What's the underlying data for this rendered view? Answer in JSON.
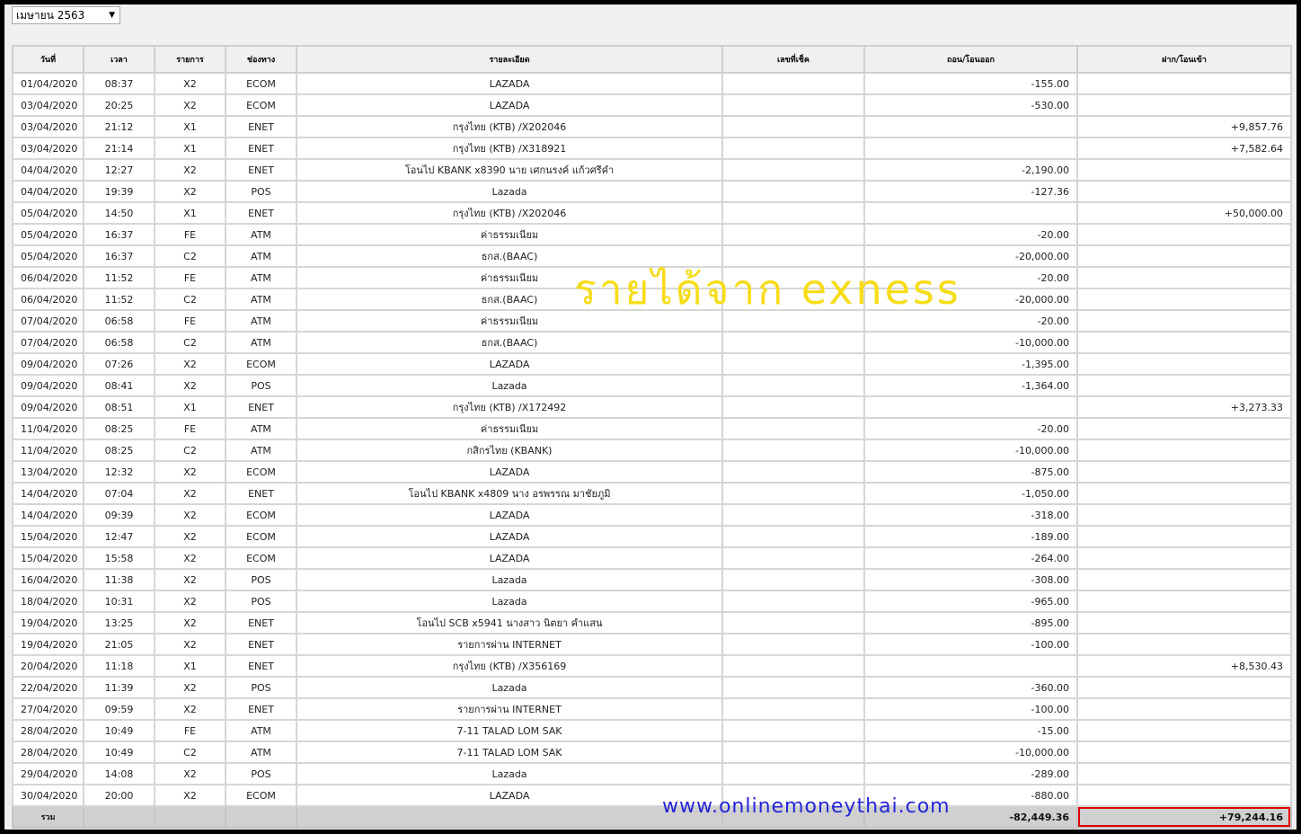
{
  "month_select": {
    "value": "เมษายน 2563",
    "arrow": "▼"
  },
  "table": {
    "headers": [
      "วันที่",
      "เวลา",
      "รายการ",
      "ช่องทาง",
      "รายละเอียด",
      "เลขที่เช็ค",
      "ถอน/โอนออก",
      "ฝาก/โอนเข้า"
    ],
    "rows": [
      [
        "01/04/2020",
        "08:37",
        "X2",
        "ECOM",
        "LAZADA",
        "",
        "-155.00",
        ""
      ],
      [
        "03/04/2020",
        "20:25",
        "X2",
        "ECOM",
        "LAZADA",
        "",
        "-530.00",
        ""
      ],
      [
        "03/04/2020",
        "21:12",
        "X1",
        "ENET",
        "กรุงไทย (KTB) /X202046",
        "",
        "",
        "+9,857.76"
      ],
      [
        "03/04/2020",
        "21:14",
        "X1",
        "ENET",
        "กรุงไทย (KTB) /X318921",
        "",
        "",
        "+7,582.64"
      ],
      [
        "04/04/2020",
        "12:27",
        "X2",
        "ENET",
        "โอนไป KBANK x8390 นาย เศกนรงค์ แก้วศรีคำ",
        "",
        "-2,190.00",
        ""
      ],
      [
        "04/04/2020",
        "19:39",
        "X2",
        "POS",
        "Lazada",
        "",
        "-127.36",
        ""
      ],
      [
        "05/04/2020",
        "14:50",
        "X1",
        "ENET",
        "กรุงไทย (KTB) /X202046",
        "",
        "",
        "+50,000.00"
      ],
      [
        "05/04/2020",
        "16:37",
        "FE",
        "ATM",
        "ค่าธรรมเนียม",
        "",
        "-20.00",
        ""
      ],
      [
        "05/04/2020",
        "16:37",
        "C2",
        "ATM",
        "ธกส.(BAAC)",
        "",
        "-20,000.00",
        ""
      ],
      [
        "06/04/2020",
        "11:52",
        "FE",
        "ATM",
        "ค่าธรรมเนียม",
        "",
        "-20.00",
        ""
      ],
      [
        "06/04/2020",
        "11:52",
        "C2",
        "ATM",
        "ธกส.(BAAC)",
        "",
        "-20,000.00",
        ""
      ],
      [
        "07/04/2020",
        "06:58",
        "FE",
        "ATM",
        "ค่าธรรมเนียม",
        "",
        "-20.00",
        ""
      ],
      [
        "07/04/2020",
        "06:58",
        "C2",
        "ATM",
        "ธกส.(BAAC)",
        "",
        "-10,000.00",
        ""
      ],
      [
        "09/04/2020",
        "07:26",
        "X2",
        "ECOM",
        "LAZADA",
        "",
        "-1,395.00",
        ""
      ],
      [
        "09/04/2020",
        "08:41",
        "X2",
        "POS",
        "Lazada",
        "",
        "-1,364.00",
        ""
      ],
      [
        "09/04/2020",
        "08:51",
        "X1",
        "ENET",
        "กรุงไทย (KTB) /X172492",
        "",
        "",
        "+3,273.33"
      ],
      [
        "11/04/2020",
        "08:25",
        "FE",
        "ATM",
        "ค่าธรรมเนียม",
        "",
        "-20.00",
        ""
      ],
      [
        "11/04/2020",
        "08:25",
        "C2",
        "ATM",
        "กสิกรไทย (KBANK)",
        "",
        "-10,000.00",
        ""
      ],
      [
        "13/04/2020",
        "12:32",
        "X2",
        "ECOM",
        "LAZADA",
        "",
        "-875.00",
        ""
      ],
      [
        "14/04/2020",
        "07:04",
        "X2",
        "ENET",
        "โอนไป KBANK x4809 นาง อรพรรณ มาชัยภูมิ",
        "",
        "-1,050.00",
        ""
      ],
      [
        "14/04/2020",
        "09:39",
        "X2",
        "ECOM",
        "LAZADA",
        "",
        "-318.00",
        ""
      ],
      [
        "15/04/2020",
        "12:47",
        "X2",
        "ECOM",
        "LAZADA",
        "",
        "-189.00",
        ""
      ],
      [
        "15/04/2020",
        "15:58",
        "X2",
        "ECOM",
        "LAZADA",
        "",
        "-264.00",
        ""
      ],
      [
        "16/04/2020",
        "11:38",
        "X2",
        "POS",
        "Lazada",
        "",
        "-308.00",
        ""
      ],
      [
        "18/04/2020",
        "10:31",
        "X2",
        "POS",
        "Lazada",
        "",
        "-965.00",
        ""
      ],
      [
        "19/04/2020",
        "13:25",
        "X2",
        "ENET",
        "โอนไป SCB x5941 นางสาว นิตยา คำแสน",
        "",
        "-895.00",
        ""
      ],
      [
        "19/04/2020",
        "21:05",
        "X2",
        "ENET",
        "รายการผ่าน INTERNET",
        "",
        "-100.00",
        ""
      ],
      [
        "20/04/2020",
        "11:18",
        "X1",
        "ENET",
        "กรุงไทย (KTB) /X356169",
        "",
        "",
        "+8,530.43"
      ],
      [
        "22/04/2020",
        "11:39",
        "X2",
        "POS",
        "Lazada",
        "",
        "-360.00",
        ""
      ],
      [
        "27/04/2020",
        "09:59",
        "X2",
        "ENET",
        "รายการผ่าน INTERNET",
        "",
        "-100.00",
        ""
      ],
      [
        "28/04/2020",
        "10:49",
        "FE",
        "ATM",
        "7-11 TALAD LOM SAK",
        "",
        "-15.00",
        ""
      ],
      [
        "28/04/2020",
        "10:49",
        "C2",
        "ATM",
        "7-11 TALAD LOM SAK",
        "",
        "-10,000.00",
        ""
      ],
      [
        "29/04/2020",
        "14:08",
        "X2",
        "POS",
        "Lazada",
        "",
        "-289.00",
        ""
      ],
      [
        "30/04/2020",
        "20:00",
        "X2",
        "ECOM",
        "LAZADA",
        "",
        "-880.00",
        ""
      ]
    ],
    "total": {
      "label": "รวม",
      "withdraw": "-82,449.36",
      "deposit": "+79,244.16"
    }
  },
  "overlay": {
    "income_text": "รายได้จาก exness",
    "website": "www.onlinemoneythai.com"
  },
  "colors": {
    "highlight": "#e00000",
    "income_text": "#f7dc18",
    "website_text": "#2424d8"
  }
}
